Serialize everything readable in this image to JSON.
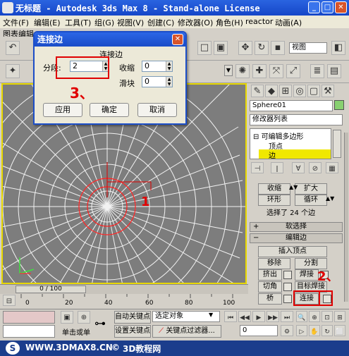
{
  "window": {
    "title": "无标题  - Autodesk 3ds Max 8  - Stand-alone License",
    "min_icon": "minimize-icon",
    "max_icon": "maximize-icon",
    "close_icon": "close-icon"
  },
  "menubar": {
    "items": [
      "文件(F)",
      "编辑(E)",
      "工具(T)",
      "组(G)",
      "视图(V)",
      "创建(C)",
      "修改器(O)",
      "角色(H)",
      "reactor",
      "动画(A)"
    ],
    "second_row": "图表编辑"
  },
  "toolbar": {
    "view_select": "视图"
  },
  "dialog": {
    "title": "连接边",
    "group_label": "连接边",
    "segments_label": "分段:",
    "segments_value": "2",
    "pinch_label": "收缩",
    "pinch_value": "0",
    "slide_label": "滑块",
    "slide_value": "0",
    "apply_label": "应用",
    "ok_label": "确定",
    "cancel_label": "取消"
  },
  "panel": {
    "object_name": "Sphere01",
    "modifier_list": "修改器列表",
    "stack": {
      "root": "可编辑多边形",
      "vertex": "顶点",
      "edge": "边"
    },
    "selection": {
      "grow": "收缩",
      "expand": "扩大",
      "ring": "环形",
      "loop": "循环",
      "status": "选择了 24 个边"
    },
    "soft_selection": "软选择",
    "edit_edges": "编辑边",
    "buttons": {
      "insert_vertex": "插入顶点",
      "remove": "移除",
      "split": "分割",
      "extrude": "挤出",
      "weld": "焊接",
      "chamfer": "切角",
      "target_weld": "目标焊接",
      "bridge": "桥",
      "connect": "连接"
    }
  },
  "timeline": {
    "frame": "0 / 100",
    "ticks": [
      "0",
      "20",
      "40",
      "60",
      "80",
      "100"
    ]
  },
  "bottom": {
    "selection_lock": "单击或单",
    "auto_key": "自动关键点",
    "set_key": "设置关键点",
    "selected_object": "选定对象",
    "key_filters": "关键点过滤器...",
    "frame_value": "0"
  },
  "annotations": {
    "step2": "2、",
    "step3": "3、"
  },
  "watermark": {
    "left": "WWW.3DMAX8.CN",
    "right": "3D教程网"
  },
  "colors": {
    "title_bar": "#1a4cc8",
    "viewport_bg": "#7d7d7d",
    "viewport_border": "#e8d800",
    "annotation_red": "#e00000",
    "stack_highlight": "#f0e800"
  }
}
